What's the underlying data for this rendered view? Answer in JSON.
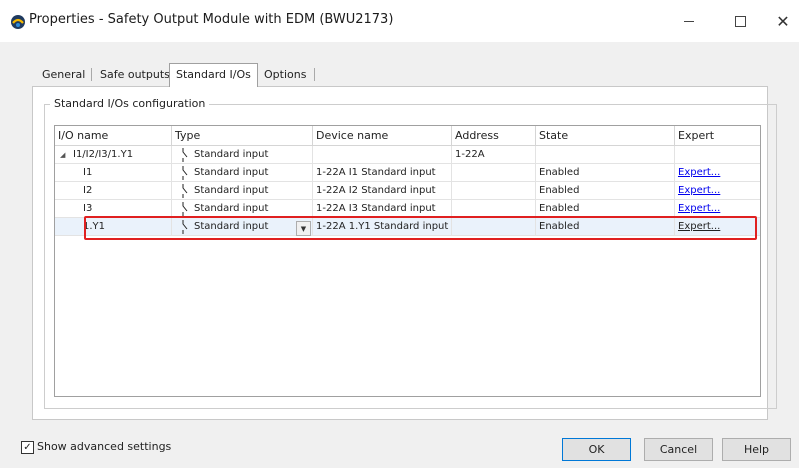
{
  "window": {
    "title": "Properties - Safety Output Module with EDM (BWU2173)",
    "minimize_icon": "minimize-icon",
    "maximize_icon": "maximize-icon",
    "close_glyph": "✕"
  },
  "tabs": [
    {
      "label": "General"
    },
    {
      "label": "Safe outputs"
    },
    {
      "label": "Standard I/Os",
      "active": true
    },
    {
      "label": "Options"
    }
  ],
  "group": {
    "label": "Standard I/Os configuration"
  },
  "grid": {
    "columns": [
      "I/O name",
      "Type",
      "Device name",
      "Address",
      "State",
      "Expert"
    ],
    "rows": [
      {
        "name": "I1/I2/I3/1.Y1",
        "type": "Standard input",
        "device": "",
        "address": "1-22A",
        "state": "",
        "expert": "",
        "expanded": true,
        "level": 0
      },
      {
        "name": "I1",
        "type": "Standard input",
        "device": "1-22A I1 Standard input",
        "address": "",
        "state": "Enabled",
        "expert": "Expert...",
        "level": 1
      },
      {
        "name": "I2",
        "type": "Standard input",
        "device": "1-22A I2 Standard input",
        "address": "",
        "state": "Enabled",
        "expert": "Expert...",
        "level": 1
      },
      {
        "name": "I3",
        "type": "Standard input",
        "device": "1-22A I3 Standard input",
        "address": "",
        "state": "Enabled",
        "expert": "Expert...",
        "level": 1
      },
      {
        "name": "1.Y1",
        "type": "Standard input",
        "device": "1-22A 1.Y1 Standard input",
        "address": "",
        "state": "Enabled",
        "expert": "Expert...",
        "level": 1,
        "selected": true
      }
    ]
  },
  "advanced": {
    "label": "Show advanced settings",
    "checked": true,
    "check_glyph": "✓"
  },
  "buttons": {
    "ok": "OK",
    "cancel": "Cancel",
    "help": "Help"
  },
  "colors": {
    "highlight": "#e02020",
    "link": "#0000ee",
    "selection": "#eaf2fb"
  }
}
